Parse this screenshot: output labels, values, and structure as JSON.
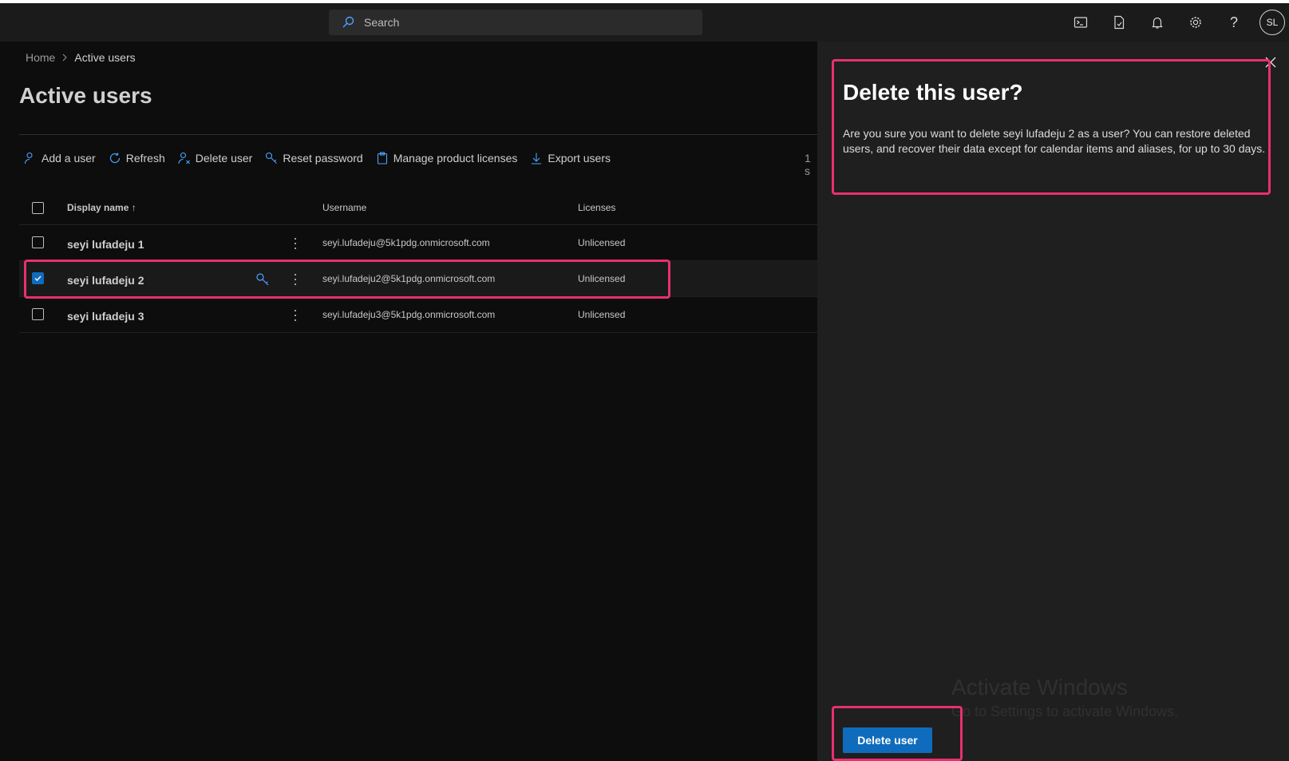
{
  "topbar": {
    "search_placeholder": "Search",
    "icons": [
      "terminal-icon",
      "document-icon",
      "bell-icon",
      "gear-icon",
      "help-icon"
    ],
    "avatar_initials": "SL"
  },
  "breadcrumb": {
    "home": "Home",
    "current": "Active users"
  },
  "page_title": "Active users",
  "commands": [
    {
      "label": "Add a user",
      "icon": "person-add-icon"
    },
    {
      "label": "Refresh",
      "icon": "refresh-icon"
    },
    {
      "label": "Delete user",
      "icon": "person-delete-icon"
    },
    {
      "label": "Reset password",
      "icon": "key-icon"
    },
    {
      "label": "Manage product licenses",
      "icon": "clipboard-icon"
    },
    {
      "label": "Export users",
      "icon": "download-icon"
    }
  ],
  "selection_count": "1 s",
  "table": {
    "headers": {
      "display_name": "Display name",
      "sort_indicator": "↑",
      "username": "Username",
      "licenses": "Licenses"
    },
    "rows": [
      {
        "display_name": "seyi lufadeju 1",
        "username": "seyi.lufadeju@5k1pdg.onmicrosoft.com",
        "licenses": "Unlicensed",
        "selected": false
      },
      {
        "display_name": "seyi lufadeju 2",
        "username": "seyi.lufadeju2@5k1pdg.onmicrosoft.com",
        "licenses": "Unlicensed",
        "selected": true
      },
      {
        "display_name": "seyi lufadeju 3",
        "username": "seyi.lufadeju3@5k1pdg.onmicrosoft.com",
        "licenses": "Unlicensed",
        "selected": false
      }
    ]
  },
  "panel": {
    "title": "Delete this user?",
    "body": "Are you sure you want to delete seyi lufadeju 2 as a user? You can restore deleted users, and recover their data except for calendar items and aliases, for up to 30 days.",
    "primary_button": "Delete user"
  },
  "watermark": {
    "line1": "Activate Windows",
    "line2": "Go to Settings to activate Windows."
  },
  "colors": {
    "accent": "#0f6cbd",
    "highlight": "#e8306f",
    "panel_bg": "#1f1f1f",
    "page_bg": "#0d0d0d"
  }
}
